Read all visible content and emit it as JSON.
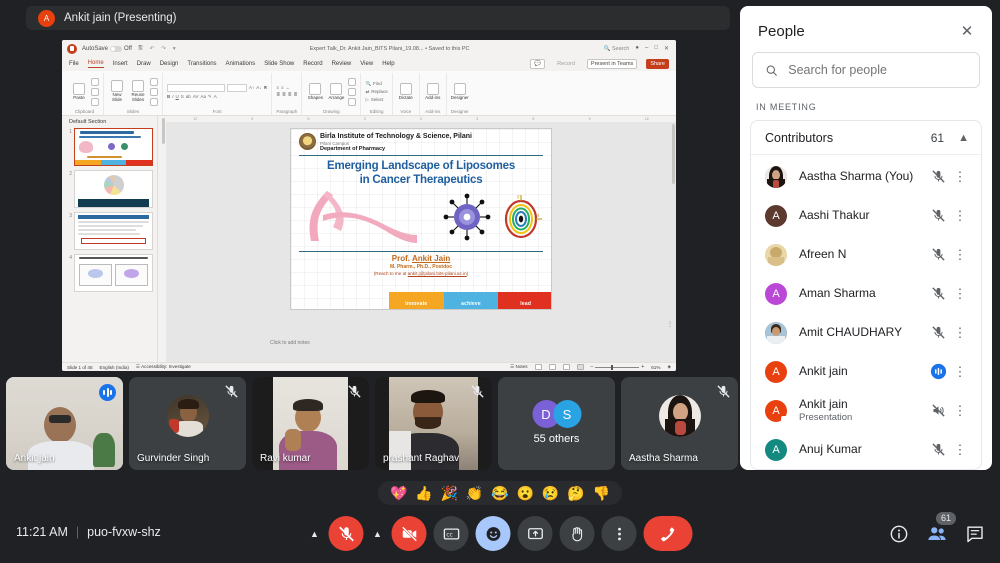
{
  "presenter_bar": {
    "avatar_initial": "A",
    "label": "Ankit jain (Presenting)",
    "avatar_color": "#e8410f"
  },
  "powerpoint": {
    "titlebar": {
      "autosave": "AutoSave",
      "toggle_state": "Off",
      "filename": "Expert Talk_Dr. Ankit Jain_BITS Pilani_19.08... • Saved to this PC",
      "search_placeholder": "Search"
    },
    "tabs": [
      "File",
      "Home",
      "Insert",
      "Draw",
      "Design",
      "Transitions",
      "Animations",
      "Slide Show",
      "Record",
      "Review",
      "View",
      "Help"
    ],
    "active_tab": "Home",
    "record_label": "Record",
    "present_in_teams": "Present in Teams",
    "share": "Share",
    "ribbon_groups": [
      {
        "name": "Clipboard",
        "items": [
          "Paste",
          "Cut",
          "Copy",
          "Format Painter"
        ]
      },
      {
        "name": "Slides",
        "items": [
          "New Slide",
          "Reuse Slides",
          "Layout",
          "Reset",
          "Section"
        ]
      },
      {
        "name": "Font",
        "items": [
          "Bold",
          "Italic",
          "Underline",
          "Strikethrough",
          "Text Shadow",
          "Character Spacing",
          "Change Case",
          "Text Highlight",
          "Font Color"
        ]
      },
      {
        "name": "Paragraph",
        "items": [
          "Bullets",
          "Numbering",
          "Align Left",
          "Center",
          "Align Right",
          "Justify"
        ]
      },
      {
        "name": "Drawing",
        "items": [
          "Shapes",
          "Arrange",
          "Quick Styles",
          "Shape Fill",
          "Shape Outline",
          "Shape Effects"
        ]
      },
      {
        "name": "Editing",
        "items": [
          "Find",
          "Replace",
          "Select"
        ]
      },
      {
        "name": "Voice",
        "items": [
          "Dictate"
        ]
      },
      {
        "name": "Add-ins",
        "items": [
          "Add-ins"
        ]
      },
      {
        "name": "Designer",
        "items": [
          "Designer"
        ]
      }
    ],
    "slide_panel": {
      "section": "Default Section",
      "slide_numbers": [
        "1",
        "2",
        "3",
        "4"
      ]
    },
    "notes_hint": "Click to add notes",
    "status": {
      "slide_counter": "Slide 1 of 45",
      "language": "English (India)",
      "accessibility": "Accessibility: Investigate",
      "notes_button": "Notes",
      "zoom_level": "61%"
    },
    "slide": {
      "university": "Birla Institute of Technology & Science,",
      "university_suffix": "Pilani",
      "campus": "Pilani Campus",
      "department": "Department of Pharmacy",
      "title_line1": "Emerging Landscape of Liposomes",
      "title_line2": "in Cancer Therapeutics",
      "presenter_prefix": "Prof.",
      "presenter_name": "Ankit Jain",
      "degrees": "M. Pharm., Ph.D., Postdoc",
      "contact_prefix": "(Reach to me at",
      "contact_email": "ankit.j@pilani.bits-pilani.ac.in",
      "contact_suffix": ")",
      "tagline": [
        "innovate",
        "achieve",
        "lead"
      ],
      "tagline_colors": [
        "#f5a623",
        "#4eb3e0",
        "#e03020"
      ]
    }
  },
  "filmstrip": [
    {
      "name": "Ankit jain",
      "state": "speaking",
      "active": true
    },
    {
      "name": "Gurvinder Singh",
      "state": "muted",
      "active": false
    },
    {
      "name": "Ravi kumar",
      "state": "muted",
      "active": false
    },
    {
      "name": "prashant Raghav",
      "state": "muted",
      "active": false
    },
    {
      "name": "55 others",
      "state": "group",
      "active": false,
      "group_initials": [
        "D",
        "S"
      ]
    },
    {
      "name": "Aastha Sharma",
      "state": "muted",
      "active": false
    }
  ],
  "emoji_bar": [
    "💖",
    "👍",
    "🎉",
    "👏",
    "😂",
    "😮",
    "😢",
    "🤔",
    "👎"
  ],
  "bottom_bar": {
    "time": "11:21 AM",
    "separator": "|",
    "meeting_code": "puo-fvxw-shz",
    "controls": [
      {
        "name": "microphone",
        "label": "Turn off microphone",
        "state": "muted"
      },
      {
        "name": "camera",
        "label": "Turn off camera",
        "state": "off"
      },
      {
        "name": "captions",
        "label": "Turn on captions",
        "state": "default"
      },
      {
        "name": "reactions",
        "label": "Send a reaction",
        "state": "active"
      },
      {
        "name": "present",
        "label": "Present now",
        "state": "default"
      },
      {
        "name": "raise-hand",
        "label": "Raise hand",
        "state": "default"
      },
      {
        "name": "more-options",
        "label": "More options",
        "state": "default"
      },
      {
        "name": "leave-call",
        "label": "Leave call",
        "state": "leave"
      }
    ],
    "right_icons": [
      {
        "name": "meeting-details",
        "label": "Meeting details"
      },
      {
        "name": "people",
        "label": "People",
        "badge": "61",
        "active": true
      },
      {
        "name": "chat",
        "label": "Chat with everyone"
      }
    ]
  },
  "people_panel": {
    "title": "People",
    "close_label": "✕",
    "search_placeholder": "Search for people",
    "search_value": "",
    "section_label": "IN MEETING",
    "group_label": "Contributors",
    "group_count": "61",
    "participants": [
      {
        "name": "Aastha Sharma (You)",
        "sub": "",
        "avatar_type": "photo",
        "avatar_color": "#b08d7a",
        "initial": "A",
        "mic": "muted",
        "pinned": false
      },
      {
        "name": "Aashi Thakur",
        "sub": "",
        "avatar_type": "initial",
        "avatar_color": "#5c3a2e",
        "initial": "A",
        "mic": "muted",
        "pinned": false
      },
      {
        "name": "Afreen N",
        "sub": "",
        "avatar_type": "photo",
        "avatar_color": "#e8d7a8",
        "initial": "A",
        "mic": "muted",
        "pinned": false
      },
      {
        "name": "Aman Sharma",
        "sub": "",
        "avatar_type": "initial",
        "avatar_color": "#bb47d6",
        "initial": "A",
        "mic": "muted",
        "pinned": false
      },
      {
        "name": "Amit CHAUDHARY",
        "sub": "",
        "avatar_type": "photo",
        "avatar_color": "#8fa9bd",
        "initial": "A",
        "mic": "muted",
        "pinned": false
      },
      {
        "name": "Ankit jain",
        "sub": "",
        "avatar_type": "initial",
        "avatar_color": "#e8410f",
        "initial": "A",
        "mic": "speaking",
        "pinned": false
      },
      {
        "name": "Ankit jain",
        "sub": "Presentation",
        "avatar_type": "initial",
        "avatar_color": "#e8410f",
        "initial": "A",
        "mic": "muted-speaker",
        "pinned": true
      },
      {
        "name": "Anuj Kumar",
        "sub": "",
        "avatar_type": "initial",
        "avatar_color": "#13897f",
        "initial": "A",
        "mic": "muted",
        "pinned": false
      }
    ]
  }
}
